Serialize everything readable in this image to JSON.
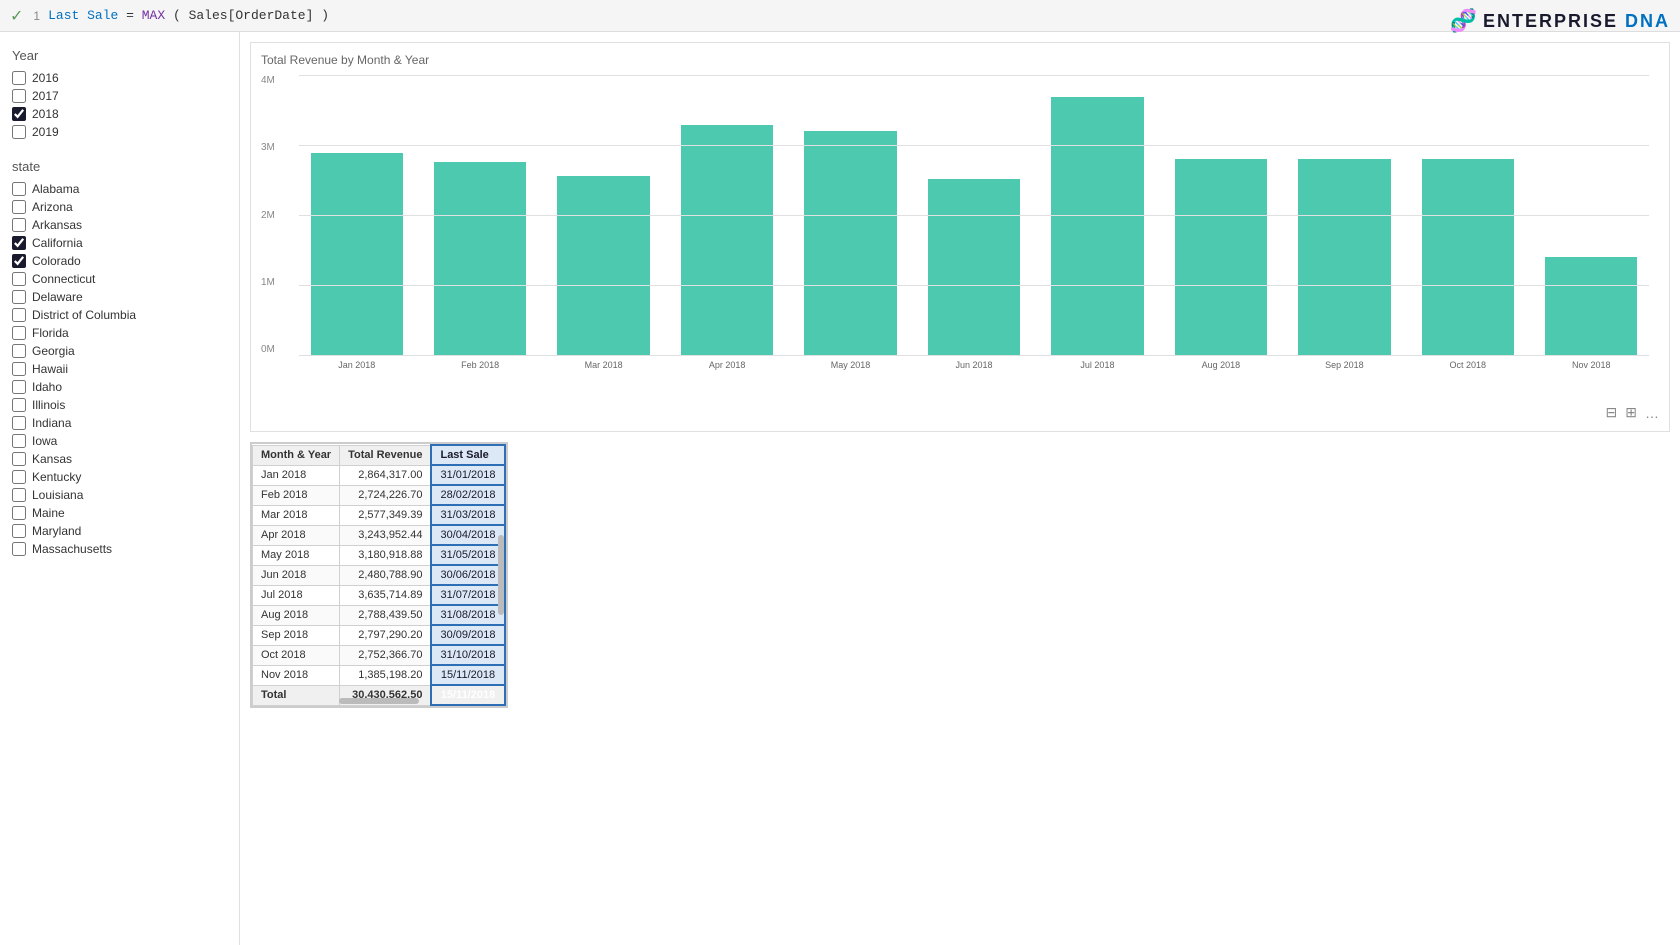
{
  "topbar": {
    "checkmark": "✓",
    "line_number": "1",
    "formula": "Last Sale = MAX( Sales[OrderDate] )"
  },
  "logo": {
    "text": "ENTERPRISE DNA",
    "dna_symbol": "🧬"
  },
  "sidebar": {
    "year_title": "Year",
    "years": [
      {
        "label": "2016",
        "checked": false
      },
      {
        "label": "2017",
        "checked": false
      },
      {
        "label": "2018",
        "checked": true
      },
      {
        "label": "2019",
        "checked": false
      }
    ],
    "state_title": "state",
    "states": [
      {
        "label": "Alabama",
        "checked": false
      },
      {
        "label": "Arizona",
        "checked": false
      },
      {
        "label": "Arkansas",
        "checked": false
      },
      {
        "label": "California",
        "checked": true
      },
      {
        "label": "Colorado",
        "checked": true
      },
      {
        "label": "Connecticut",
        "checked": false
      },
      {
        "label": "Delaware",
        "checked": false
      },
      {
        "label": "District of Columbia",
        "checked": false
      },
      {
        "label": "Florida",
        "checked": false
      },
      {
        "label": "Georgia",
        "checked": false
      },
      {
        "label": "Hawaii",
        "checked": false
      },
      {
        "label": "Idaho",
        "checked": false
      },
      {
        "label": "Illinois",
        "checked": false
      },
      {
        "label": "Indiana",
        "checked": false
      },
      {
        "label": "Iowa",
        "checked": false
      },
      {
        "label": "Kansas",
        "checked": false
      },
      {
        "label": "Kentucky",
        "checked": false
      },
      {
        "label": "Louisiana",
        "checked": false
      },
      {
        "label": "Maine",
        "checked": false
      },
      {
        "label": "Maryland",
        "checked": false
      },
      {
        "label": "Massachusetts",
        "checked": false
      }
    ]
  },
  "chart": {
    "title": "Total Revenue by Month & Year",
    "y_labels": [
      "4M",
      "3M",
      "2M",
      "1M",
      "0M"
    ],
    "bars": [
      {
        "label": "Jan 2018",
        "height_pct": 72
      },
      {
        "label": "Feb 2018",
        "height_pct": 69
      },
      {
        "label": "Mar 2018",
        "height_pct": 64
      },
      {
        "label": "Apr 2018",
        "height_pct": 82
      },
      {
        "label": "May 2018",
        "height_pct": 80
      },
      {
        "label": "Jun 2018",
        "height_pct": 63
      },
      {
        "label": "Jul 2018",
        "height_pct": 92
      },
      {
        "label": "Aug 2018",
        "height_pct": 70
      },
      {
        "label": "Sep 2018",
        "height_pct": 70
      },
      {
        "label": "Oct 2018",
        "height_pct": 70
      },
      {
        "label": "Nov 2018",
        "height_pct": 35
      }
    ]
  },
  "table": {
    "headers": [
      "Month & Year",
      "Total Revenue",
      "Last Sale"
    ],
    "rows": [
      {
        "month": "Jan 2018",
        "revenue": "2,864,317.00",
        "last_sale": "31/01/2018"
      },
      {
        "month": "Feb 2018",
        "revenue": "2,724,226.70",
        "last_sale": "28/02/2018"
      },
      {
        "month": "Mar 2018",
        "revenue": "2,577,349.39",
        "last_sale": "31/03/2018"
      },
      {
        "month": "Apr 2018",
        "revenue": "3,243,952.44",
        "last_sale": "30/04/2018"
      },
      {
        "month": "May 2018",
        "revenue": "3,180,918.88",
        "last_sale": "31/05/2018"
      },
      {
        "month": "Jun 2018",
        "revenue": "2,480,788.90",
        "last_sale": "30/06/2018"
      },
      {
        "month": "Jul 2018",
        "revenue": "3,635,714.89",
        "last_sale": "31/07/2018"
      },
      {
        "month": "Aug 2018",
        "revenue": "2,788,439.50",
        "last_sale": "31/08/2018"
      },
      {
        "month": "Sep 2018",
        "revenue": "2,797,290.20",
        "last_sale": "30/09/2018"
      },
      {
        "month": "Oct 2018",
        "revenue": "2,752,366.70",
        "last_sale": "31/10/2018"
      },
      {
        "month": "Nov 2018",
        "revenue": "1,385,198.20",
        "last_sale": "15/11/2018"
      }
    ],
    "total_row": {
      "label": "Total",
      "revenue": "30,430,562.50",
      "last_sale": "15/11/2018"
    }
  },
  "icons": {
    "filter": "⊟",
    "expand": "⊞",
    "more": "…"
  }
}
